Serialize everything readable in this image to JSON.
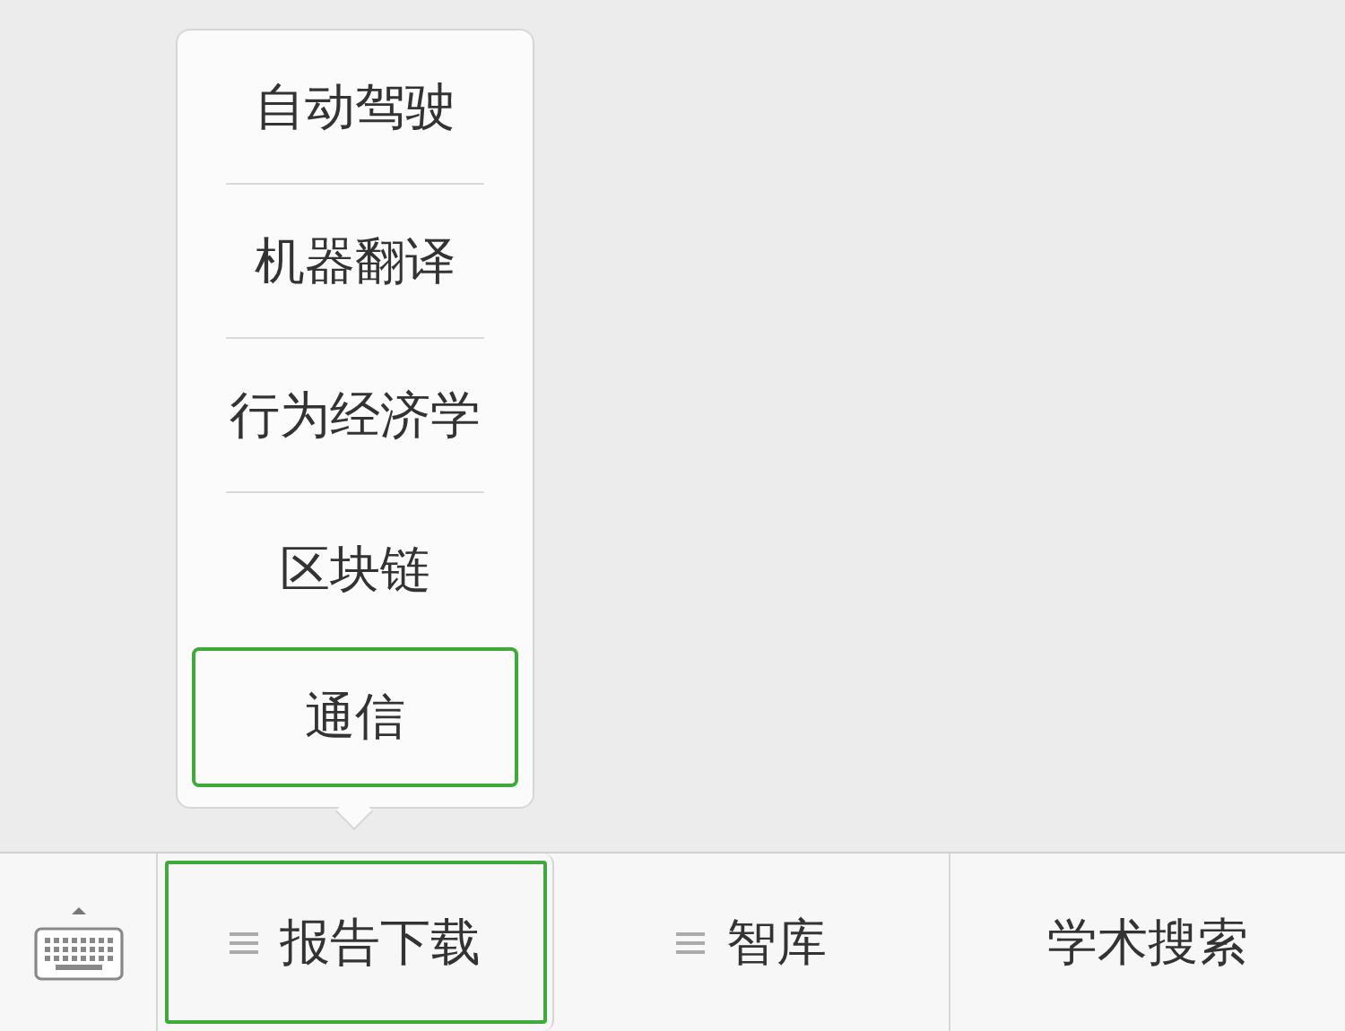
{
  "submenu": {
    "items": [
      {
        "label": "自动驾驶",
        "selected": false
      },
      {
        "label": "机器翻译",
        "selected": false
      },
      {
        "label": "行为经济学",
        "selected": false
      },
      {
        "label": "区块链",
        "selected": false
      },
      {
        "label": "通信",
        "selected": true
      }
    ]
  },
  "menu_bar": {
    "tabs": [
      {
        "label": "报告下载",
        "has_submenu": true,
        "selected": true
      },
      {
        "label": "智库",
        "has_submenu": true,
        "selected": false
      },
      {
        "label": "学术搜索",
        "has_submenu": false,
        "selected": false
      }
    ]
  }
}
